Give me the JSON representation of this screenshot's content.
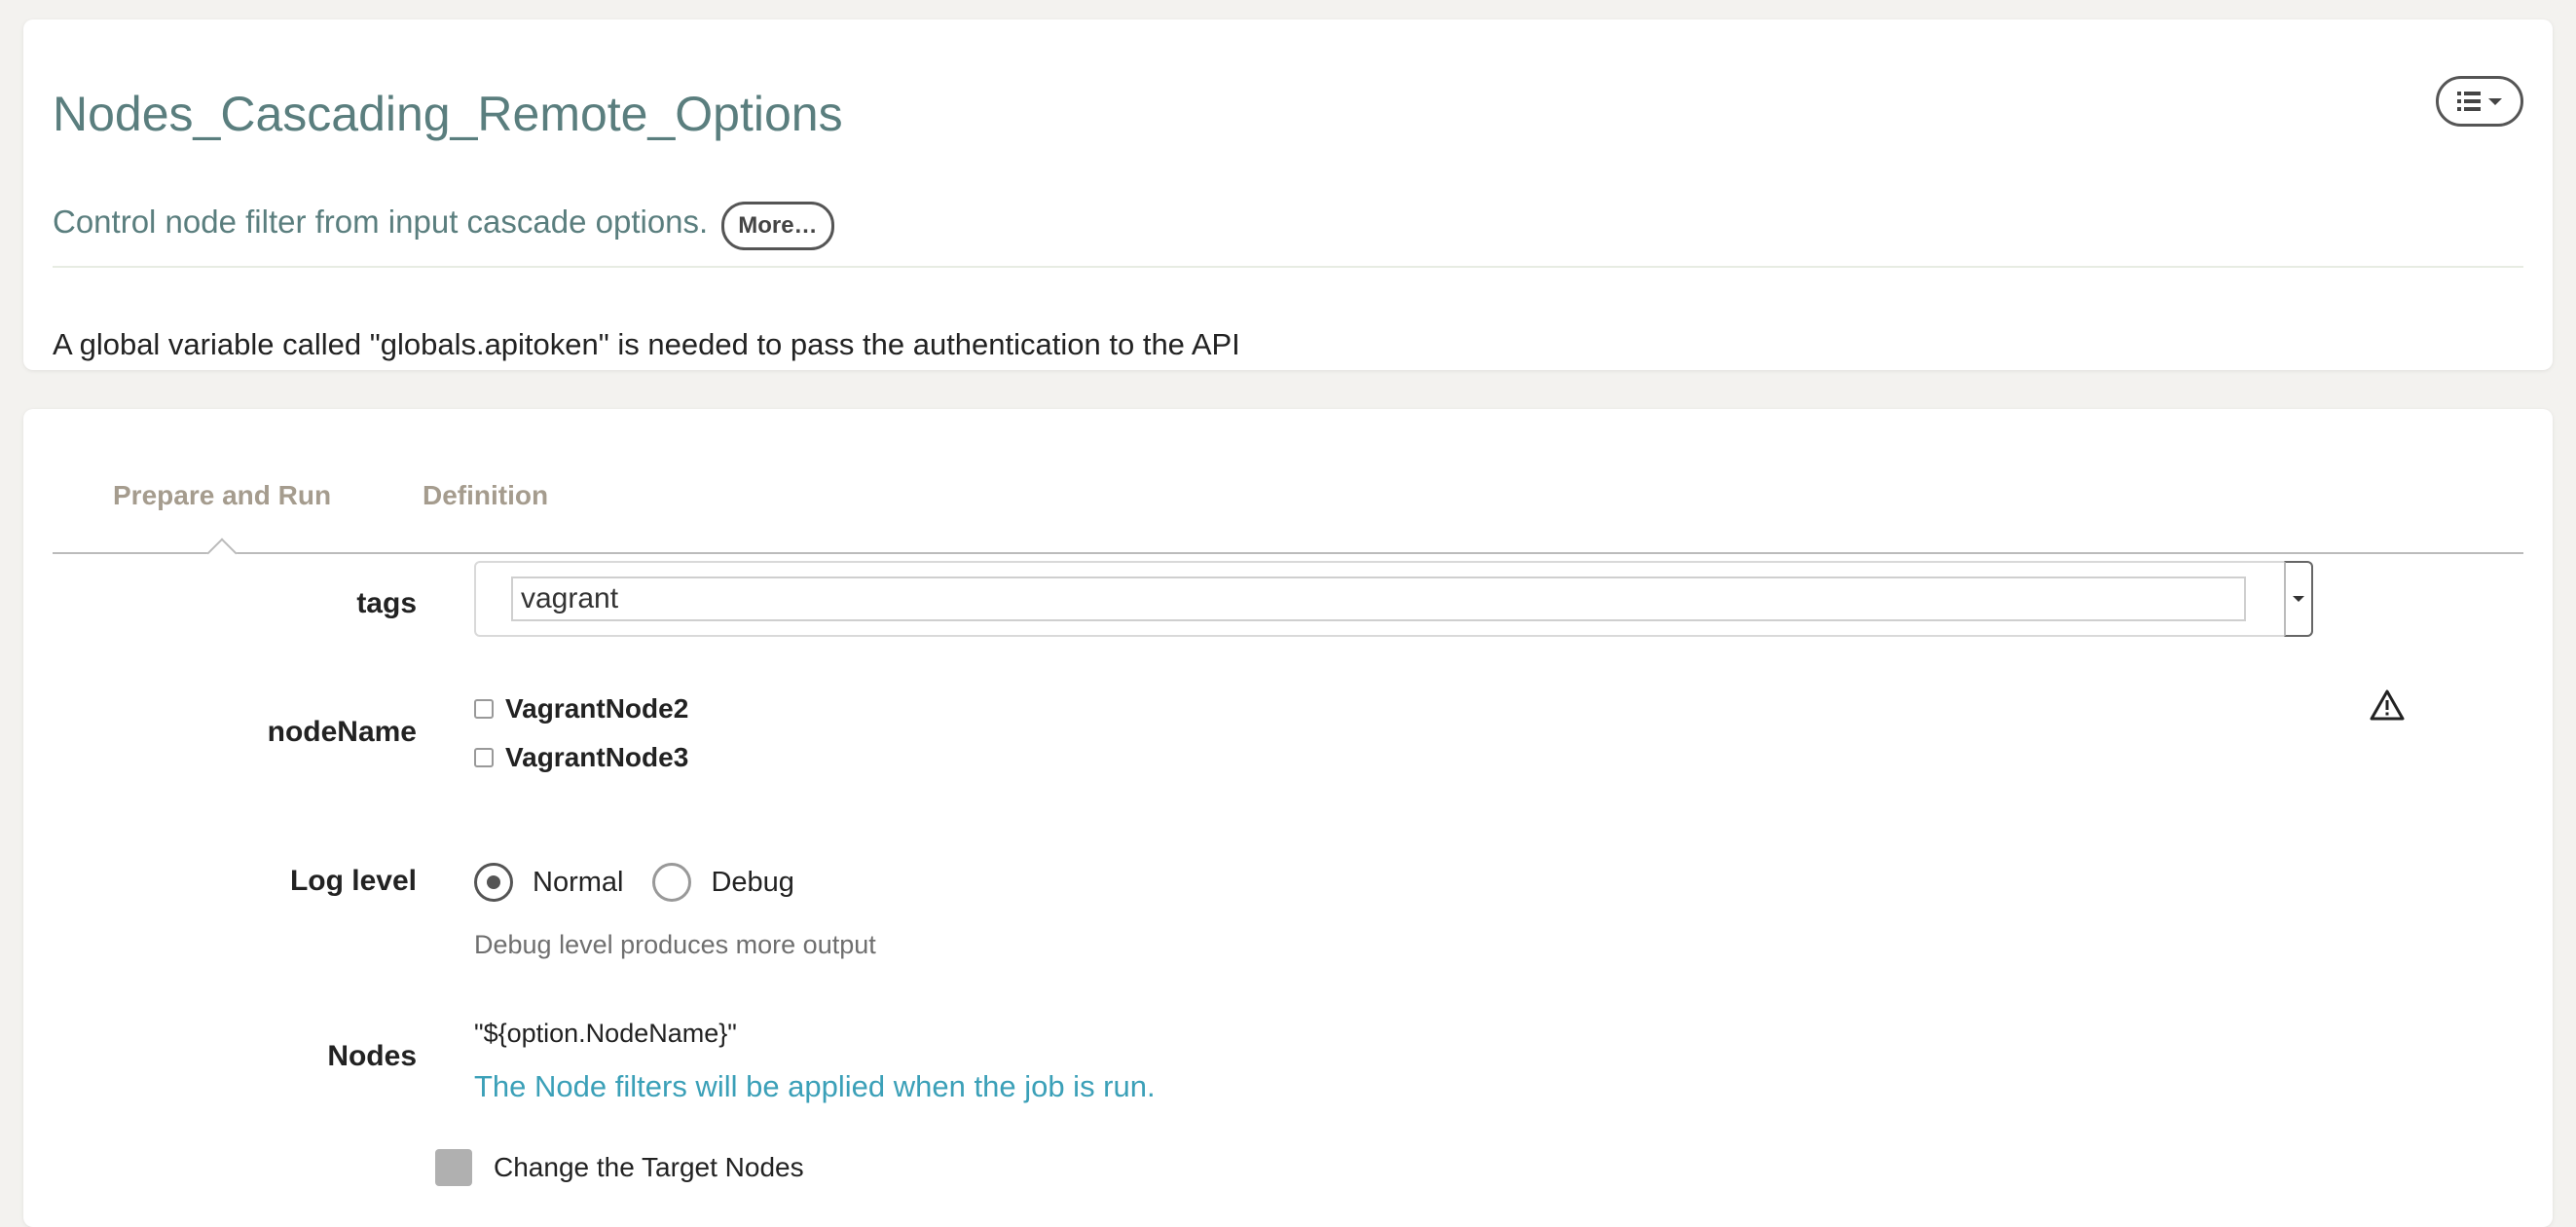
{
  "job": {
    "title": "Nodes_Cascading_Remote_Options",
    "description": "Control node filter from input cascade options.",
    "more_label": "More…",
    "extended_description": "A global variable called \"globals.apitoken\" is needed to pass the authentication to the API",
    "actions_icon": "list-icon"
  },
  "tabs": [
    {
      "label": "Prepare and Run",
      "active": true
    },
    {
      "label": "Definition",
      "active": false
    }
  ],
  "options": {
    "tags": {
      "label": "tags",
      "value": "vagrant"
    },
    "nodeName": {
      "label": "nodeName",
      "choices": [
        {
          "label": "VagrantNode2",
          "checked": false
        },
        {
          "label": "VagrantNode3",
          "checked": false
        }
      ],
      "warning_icon": "warning-icon"
    }
  },
  "log_level": {
    "label": "Log level",
    "options": [
      {
        "label": "Normal",
        "selected": true
      },
      {
        "label": "Debug",
        "selected": false
      }
    ],
    "help": "Debug level produces more output"
  },
  "nodes": {
    "label": "Nodes",
    "filter": "\"${option.NodeName}\"",
    "note": "The Node filters will be applied when the job is run.",
    "change_target_label": "Change the Target Nodes"
  },
  "colors": {
    "title": "#5a7e7e",
    "tab": "#a59c8e",
    "note": "#3ba0b8",
    "background": "#f3f2ef"
  }
}
